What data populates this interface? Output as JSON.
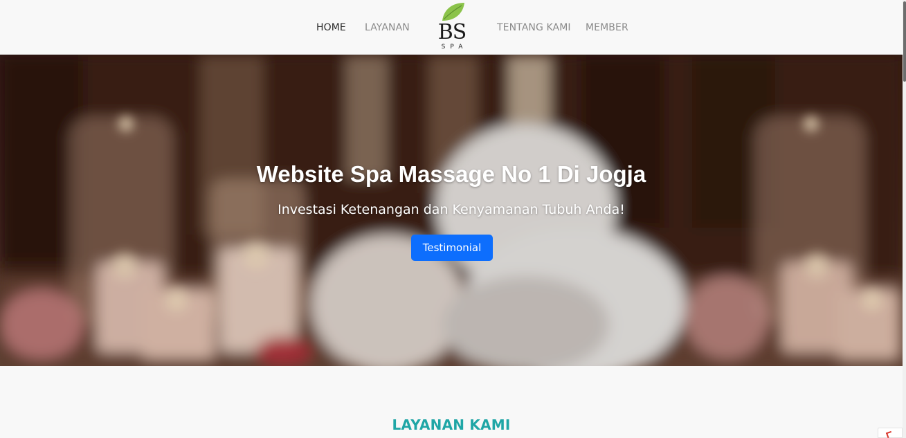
{
  "navbar": {
    "links": {
      "home": "HOME",
      "layanan": "LAYANAN",
      "tentang": "TENTANG KAMI",
      "member": "MEMBER"
    },
    "logo": {
      "text_main": "BS",
      "text_sub": "SPA",
      "icon": "leaf-icon",
      "leaf_color": "#7cb342"
    }
  },
  "hero": {
    "title": "Website Spa Massage No 1 Di Jogja",
    "subtitle": "Investasi Ketenangan dan Kenyamanan Tubuh Anda!",
    "button_label": "Testimonial",
    "button_color": "#0d6efd"
  },
  "section": {
    "title": "LAYANAN KAMI",
    "title_color": "#1fa6a6"
  }
}
